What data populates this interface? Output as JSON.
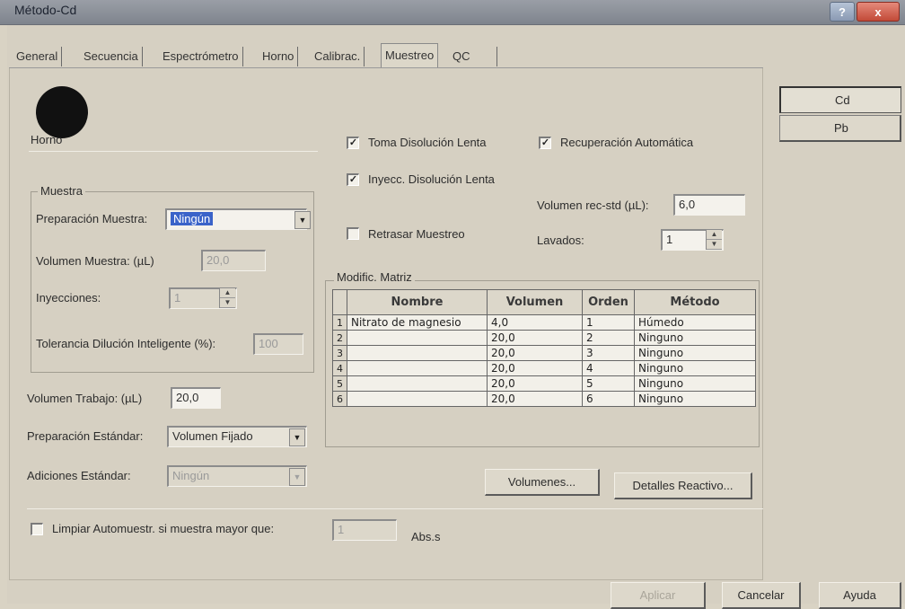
{
  "window": {
    "title": "Método-Cd",
    "help_label": "?",
    "close_label": "x"
  },
  "tabs": [
    {
      "label": "General"
    },
    {
      "label": "Secuencia"
    },
    {
      "label": "Espectrómetro"
    },
    {
      "label": "Horno"
    },
    {
      "label": "Calibrac."
    },
    {
      "label": "Muestreo"
    },
    {
      "label": "QC"
    }
  ],
  "side_buttons": [
    {
      "label": "Cd"
    },
    {
      "label": "Pb"
    }
  ],
  "horno_label": "Horno",
  "muestra": {
    "group_label": "Muestra",
    "prep_label": "Preparación Muestra:",
    "prep_value": "Ningún",
    "volumen_label": "Volumen Muestra: (µL)",
    "volumen_value": "20,0",
    "inyecciones_label": "Inyecciones:",
    "inyecciones_value": "1",
    "tolerancia_label": "Tolerancia Dilución Inteligente (%):",
    "tolerancia_value": "100"
  },
  "trabajo": {
    "volumen_label": "Volumen Trabajo: (µL)",
    "volumen_value": "20,0",
    "prep_std_label": "Preparación Estándar:",
    "prep_std_value": "Volumen Fijado",
    "adiciones_label": "Adiciones Estándar:",
    "adiciones_value": "Ningún"
  },
  "checks": {
    "toma_lenta": "Toma Disolución Lenta",
    "inyecc_lenta": "Inyecc. Disolución Lenta",
    "retrasar": "Retrasar Muestreo",
    "recuperacion": "Recuperación Automática",
    "limpiar": "Limpiar Automuestr. si muestra mayor que:",
    "check_mark": "✓"
  },
  "recuperacion": {
    "volumen_label": "Volumen rec-std (µL):",
    "volumen_value": "6,0",
    "lavados_label": "Lavados:",
    "lavados_value": "1"
  },
  "matriz": {
    "group_label": "Modific. Matriz",
    "columns": [
      "Nombre",
      "Volumen",
      "Orden",
      "Método"
    ],
    "rows": [
      {
        "n": "1",
        "nombre": "Nitrato de magnesio",
        "volumen": "4,0",
        "orden": "1",
        "metodo": "Húmedo"
      },
      {
        "n": "2",
        "nombre": "",
        "volumen": "20,0",
        "orden": "2",
        "metodo": "Ninguno"
      },
      {
        "n": "3",
        "nombre": "",
        "volumen": "20,0",
        "orden": "3",
        "metodo": "Ninguno"
      },
      {
        "n": "4",
        "nombre": "",
        "volumen": "20,0",
        "orden": "4",
        "metodo": "Ninguno"
      },
      {
        "n": "5",
        "nombre": "",
        "volumen": "20,0",
        "orden": "5",
        "metodo": "Ninguno"
      },
      {
        "n": "6",
        "nombre": "",
        "volumen": "20,0",
        "orden": "6",
        "metodo": "Ninguno"
      }
    ]
  },
  "buttons": {
    "volumenes": "Volumenes...",
    "detalles": "Detalles Reactivo...",
    "aplicar": "Aplicar",
    "cancelar": "Cancelar",
    "ayuda": "Ayuda"
  },
  "limpiar": {
    "value": "1",
    "unit": "Abs.s"
  },
  "icons": {
    "dropdown": "▼",
    "spin_up": "▲",
    "spin_down": "▼"
  }
}
